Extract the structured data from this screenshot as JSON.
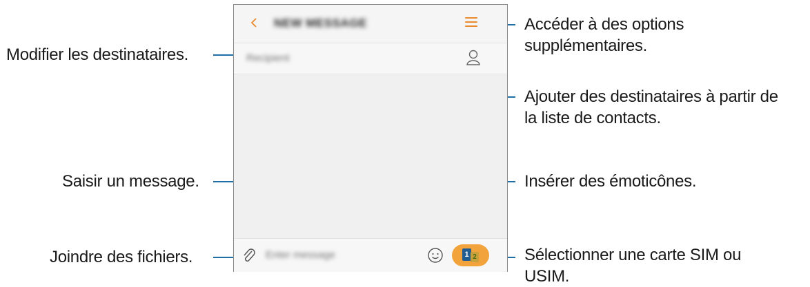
{
  "app": {
    "title": "NEW MESSAGE",
    "recipient_placeholder": "Recipient",
    "message_placeholder": "Enter message",
    "sim_labels": {
      "sim1": "1",
      "sim2": "2"
    }
  },
  "callouts": {
    "options": [
      "Accéder à des options",
      "supplémentaires."
    ],
    "recipients": "Modifier les destinataires.",
    "contacts": [
      "Ajouter des destinataires à partir de",
      "la liste de contacts."
    ],
    "message": "Saisir un message.",
    "emoticons": "Insérer des émoticônes.",
    "attach": "Joindre des fichiers.",
    "sim": [
      "Sélectionner une carte SIM ou",
      "USIM."
    ]
  },
  "colors": {
    "accent": "#e98a2c",
    "sim_button": "#f2a33c",
    "leader_line": "#1d6fa5",
    "frame": "#8a8a8a"
  },
  "icons": {
    "back": "chevron-left-icon",
    "menu": "more-options-icon",
    "contacts": "contacts-icon",
    "attach": "paperclip-icon",
    "emoji": "emoji-icon",
    "sim": "sim-card-icon"
  }
}
